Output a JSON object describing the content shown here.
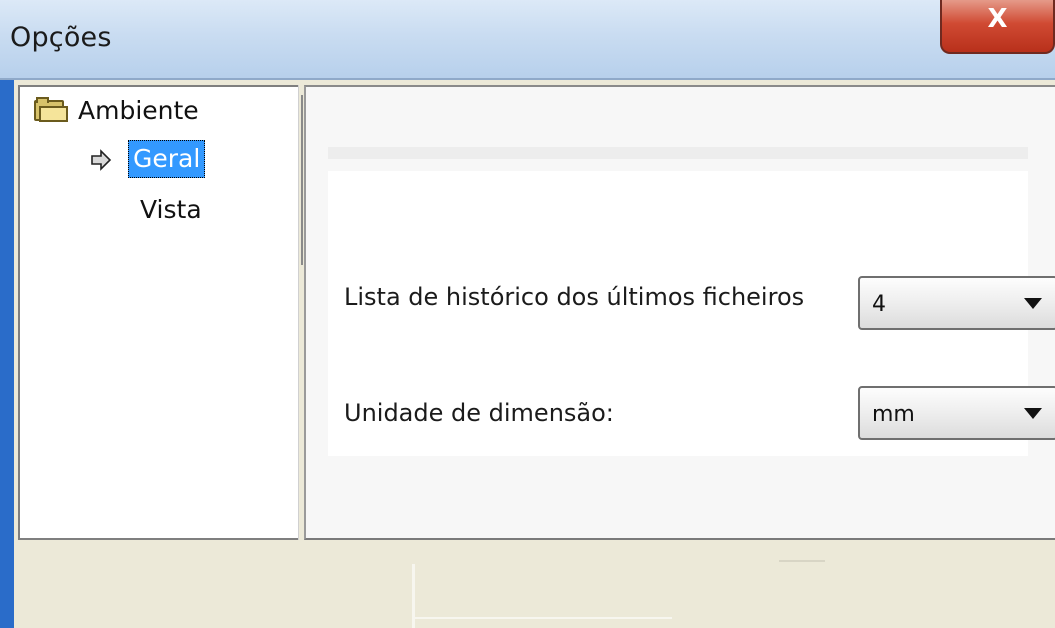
{
  "window": {
    "title": "Opções",
    "close_label": "X"
  },
  "tree": {
    "root": {
      "label": "Ambiente",
      "icon": "folder-open-icon"
    },
    "children": [
      {
        "label": "Geral",
        "selected": true,
        "icon": "arrow-right-icon"
      },
      {
        "label": "Vista",
        "selected": false
      }
    ]
  },
  "settings": {
    "history_label": "Lista de histórico dos últimos ficheiros",
    "history_value": "4",
    "unit_label": "Unidade de dimensão:",
    "unit_value": "mm"
  },
  "colors": {
    "selection": "#3399ff",
    "close_button": "#c84a33",
    "titlebar": "#c9dcf1"
  }
}
